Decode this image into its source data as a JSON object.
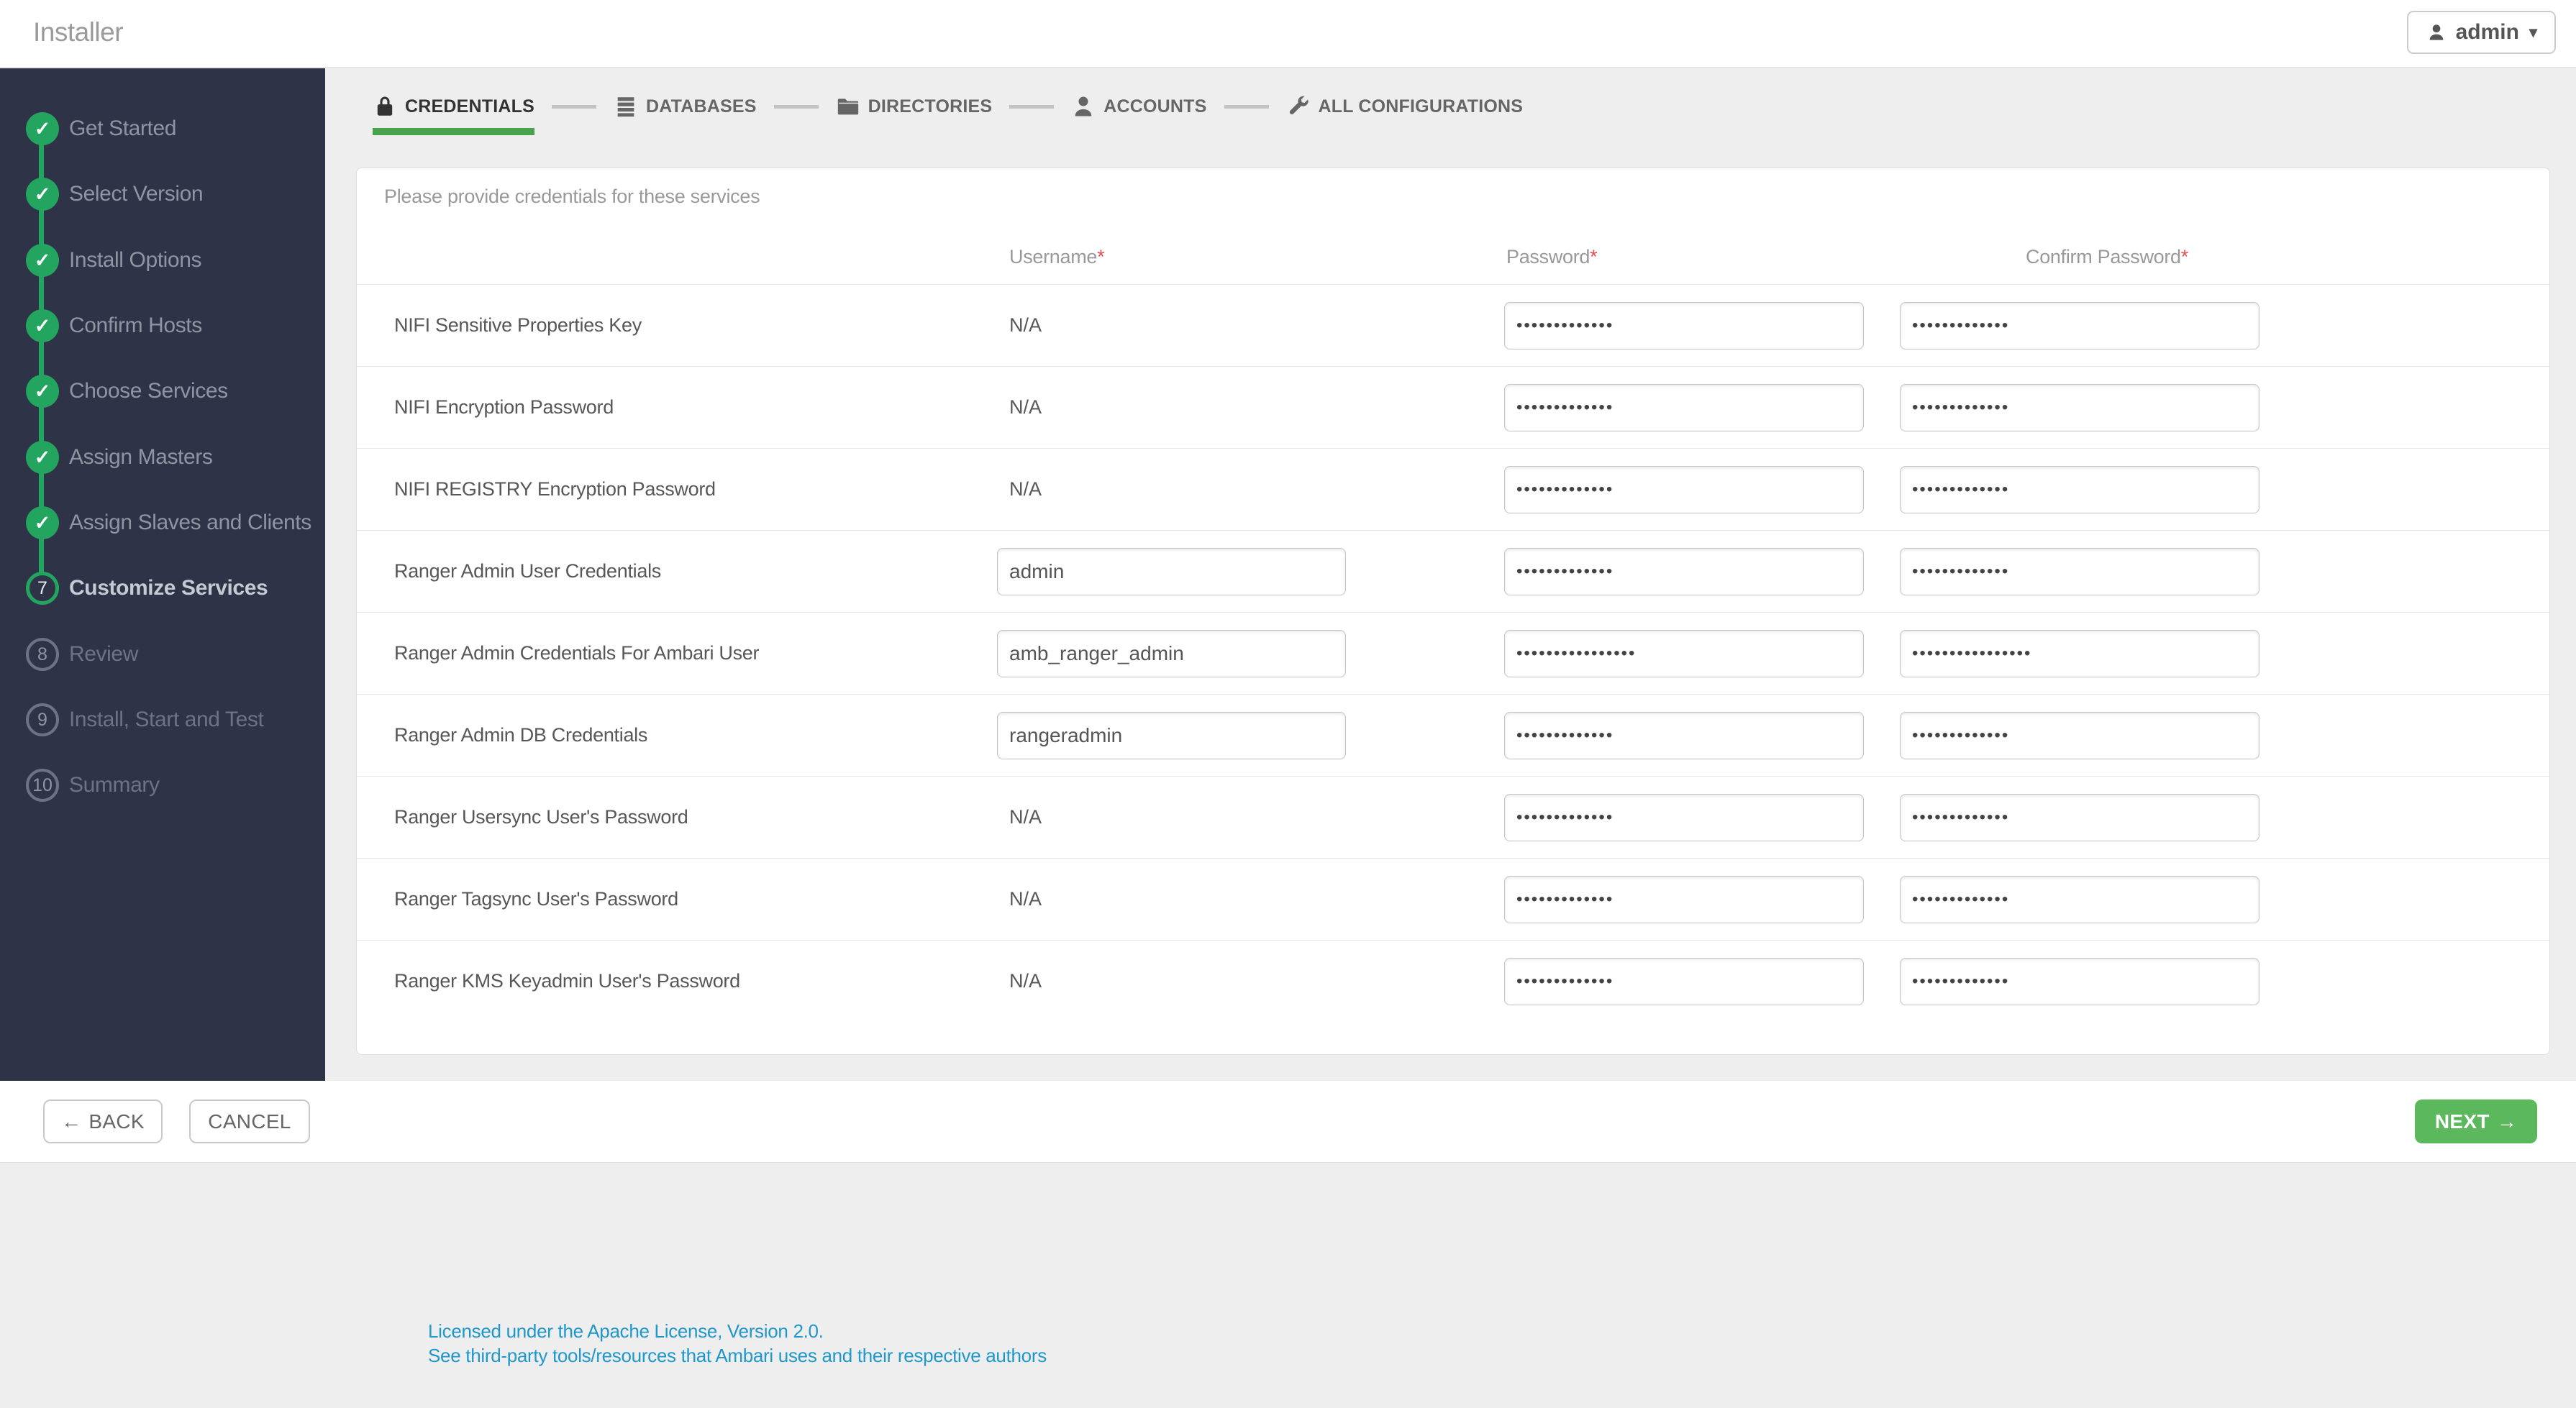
{
  "header": {
    "title": "Installer",
    "user": {
      "label": "admin",
      "caret": "▾"
    }
  },
  "icons": {
    "check": "✓"
  },
  "sidebar": {
    "steps": [
      {
        "label": "Get Started",
        "status": "done"
      },
      {
        "label": "Select Version",
        "status": "done"
      },
      {
        "label": "Install Options",
        "status": "done"
      },
      {
        "label": "Confirm Hosts",
        "status": "done"
      },
      {
        "label": "Choose Services",
        "status": "done"
      },
      {
        "label": "Assign Masters",
        "status": "done"
      },
      {
        "label": "Assign Slaves and Clients",
        "status": "done"
      },
      {
        "label": "Customize Services",
        "status": "current",
        "number": "7"
      },
      {
        "label": "Review",
        "status": "pending",
        "number": "8"
      },
      {
        "label": "Install, Start and Test",
        "status": "pending",
        "number": "9"
      },
      {
        "label": "Summary",
        "status": "pending",
        "number": "10"
      }
    ]
  },
  "tabs": [
    {
      "label": "CREDENTIALS",
      "icon": "lock-icon",
      "active": true
    },
    {
      "label": "DATABASES",
      "icon": "database-icon",
      "active": false
    },
    {
      "label": "DIRECTORIES",
      "icon": "folder-icon",
      "active": false
    },
    {
      "label": "ACCOUNTS",
      "icon": "user-icon",
      "active": false
    },
    {
      "label": "ALL CONFIGURATIONS",
      "icon": "wrench-icon",
      "active": false
    }
  ],
  "credentials_panel": {
    "note": "Please provide credentials for these services",
    "columns": {
      "username": "Username",
      "password": "Password",
      "confirm_password": "Confirm Password",
      "required_marker": "*"
    },
    "rows": [
      {
        "service": "NIFI Sensitive Properties Key",
        "username": "N/A",
        "password_mask": "•••••••••••••",
        "confirm_mask": "•••••••••••••"
      },
      {
        "service": "NIFI Encryption Password",
        "username": "N/A",
        "password_mask": "•••••••••••••",
        "confirm_mask": "•••••••••••••"
      },
      {
        "service": "NIFI REGISTRY Encryption Password",
        "username": "N/A",
        "password_mask": "•••••••••••••",
        "confirm_mask": "•••••••••••••"
      },
      {
        "service": "Ranger Admin User Credentials",
        "username_value": "admin",
        "password_mask": "•••••••••••••",
        "confirm_mask": "•••••••••••••"
      },
      {
        "service": "Ranger Admin Credentials For Ambari User",
        "username_value": "amb_ranger_admin",
        "password_mask": "••••••••••••••••",
        "confirm_mask": "••••••••••••••••"
      },
      {
        "service": "Ranger Admin DB Credentials",
        "username_value": "rangeradmin",
        "password_mask": "•••••••••••••",
        "confirm_mask": "•••••••••••••"
      },
      {
        "service": "Ranger Usersync User's Password",
        "username": "N/A",
        "password_mask": "•••••••••••••",
        "confirm_mask": "•••••••••••••"
      },
      {
        "service": "Ranger Tagsync User's Password",
        "username": "N/A",
        "password_mask": "•••••••••••••",
        "confirm_mask": "•••••••••••••"
      },
      {
        "service": "Ranger KMS Keyadmin User's Password",
        "username": "N/A",
        "password_mask": "•••••••••••••",
        "confirm_mask": "•••••••••••••"
      }
    ]
  },
  "actions": {
    "back": {
      "arrow": "←",
      "label": "BACK"
    },
    "cancel": {
      "label": "CANCEL"
    },
    "next": {
      "label": "NEXT",
      "arrow": "→"
    }
  },
  "footer": {
    "license_link": "Licensed under the Apache License, Version 2.0.",
    "thirdparty_link": "See third-party tools/resources that Ambari uses and their respective authors"
  }
}
